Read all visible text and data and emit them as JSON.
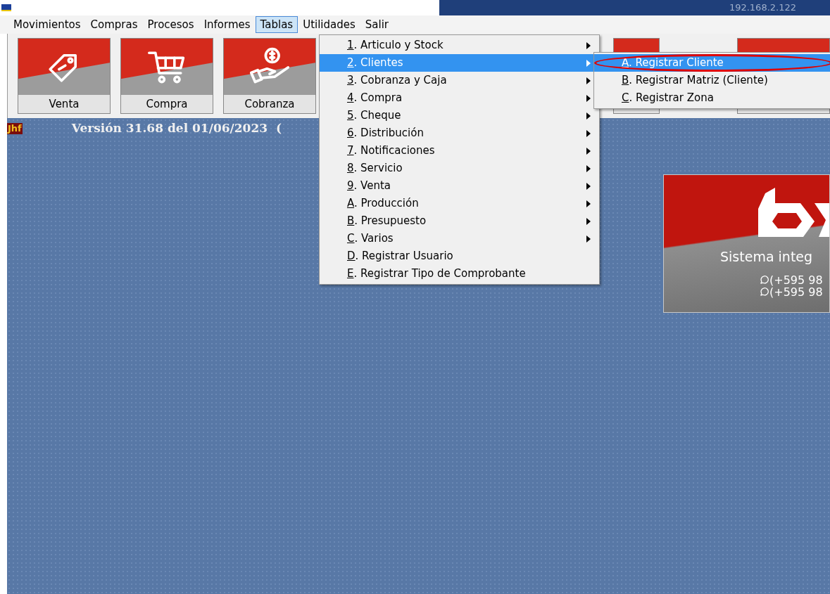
{
  "title_bar": {
    "address": "192.168.2.122"
  },
  "menu_bar": [
    {
      "label": "Movimientos",
      "selected": false
    },
    {
      "label": "Compras",
      "selected": false
    },
    {
      "label": "Procesos",
      "selected": false
    },
    {
      "label": "Informes",
      "selected": false
    },
    {
      "label": "Tablas",
      "selected": true
    },
    {
      "label": "Utilidades",
      "selected": false
    },
    {
      "label": "Salir",
      "selected": false
    }
  ],
  "toolbar": [
    {
      "label": "Venta",
      "kind": "tag"
    },
    {
      "label": "Compra",
      "kind": "cart"
    },
    {
      "label": "Cobranza",
      "kind": "coin"
    }
  ],
  "version": {
    "badge": "Jhf",
    "text": "Versión 31.68 del 01/06/2023  ("
  },
  "tablas_menu": [
    {
      "key": "1",
      "rest": ". Articulo y Stock",
      "submenu": true,
      "selected": false
    },
    {
      "key": "2",
      "rest": ". Clientes",
      "submenu": true,
      "selected": true
    },
    {
      "key": "3",
      "rest": ". Cobranza y Caja",
      "submenu": true,
      "selected": false
    },
    {
      "key": "4",
      "rest": ". Compra",
      "submenu": true,
      "selected": false
    },
    {
      "key": "5",
      "rest": ". Cheque",
      "submenu": true,
      "selected": false
    },
    {
      "key": "6",
      "rest": ". Distribución",
      "submenu": true,
      "selected": false
    },
    {
      "key": "7",
      "rest": ". Notificaciones",
      "submenu": true,
      "selected": false
    },
    {
      "key": "8",
      "rest": ". Servicio",
      "submenu": true,
      "selected": false
    },
    {
      "key": "9",
      "rest": ". Venta",
      "submenu": true,
      "selected": false
    },
    {
      "key": "A",
      "rest": ". Producción",
      "submenu": true,
      "selected": false
    },
    {
      "key": "B",
      "rest": ". Presupuesto",
      "submenu": true,
      "selected": false
    },
    {
      "key": "C",
      "rest": ". Varios",
      "submenu": true,
      "selected": false
    },
    {
      "key": "D",
      "rest": ". Registrar Usuario",
      "submenu": false,
      "selected": false
    },
    {
      "key": "E",
      "rest": ". Registrar Tipo de Comprobante",
      "submenu": false,
      "selected": false
    }
  ],
  "clientes_submenu": [
    {
      "key": "A",
      "rest": ". Registrar Cliente",
      "selected": true,
      "circled": true
    },
    {
      "key": "B",
      "rest": ". Registrar Matriz (Cliente)",
      "selected": false,
      "circled": false
    },
    {
      "key": "C",
      "rest": ". Registrar Zona",
      "selected": false,
      "circled": false
    }
  ],
  "promo_card": {
    "tagline": "Sistema integ",
    "phones": [
      "(+595 98",
      "(+595 98"
    ]
  }
}
